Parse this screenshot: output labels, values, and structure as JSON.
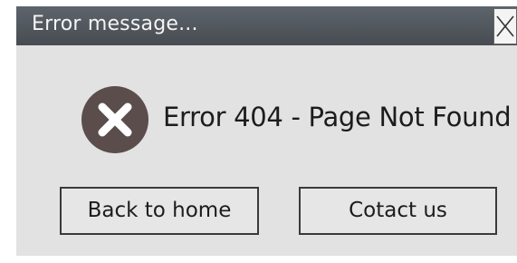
{
  "window": {
    "title": "Error message...",
    "close_icon": "close-icon"
  },
  "body": {
    "icon": "error-x-icon",
    "icon_color": "#5a4d4b",
    "message": "Error 404 - Page Not Found"
  },
  "buttons": {
    "home_label": "Back to home",
    "contact_label": "Cotact us"
  },
  "colors": {
    "titlebar": "#4f545b",
    "dialog_background": "#e2e2e2",
    "text": "#1c1c1c"
  }
}
